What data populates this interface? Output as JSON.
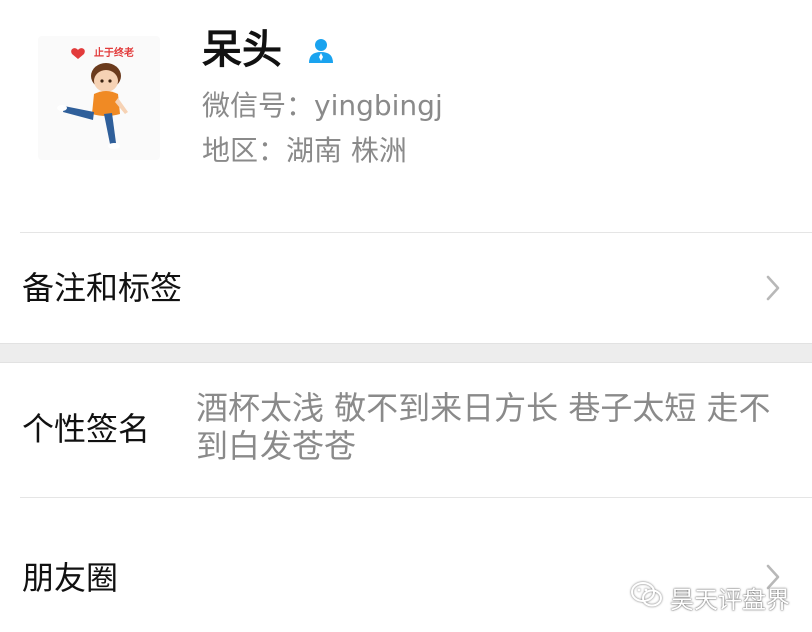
{
  "profile": {
    "name": "呆头",
    "wechat_id": "微信号：yingbingj",
    "region": "地区：湖南 株洲",
    "avatar_sticker_text": "止于终老",
    "gender_icon": "male-user-icon",
    "gender_color": "#1aa3ef"
  },
  "rows": {
    "remark_tags": {
      "label": "备注和标签",
      "icon": "chevron-right-icon"
    },
    "signature": {
      "label": "个性签名",
      "value": "酒杯太浅 敬不到来日方长 巷子太短 走不到白发苍苍"
    },
    "moments": {
      "label": "朋友圈",
      "icon": "chevron-right-icon"
    }
  },
  "watermark": {
    "text": "昊天评盘界",
    "icon": "wechat-icon"
  },
  "colors": {
    "primary_text": "#111111",
    "secondary_text": "#8a8a8a",
    "divider": "#e5e5e5",
    "section_gap": "#ededed"
  }
}
